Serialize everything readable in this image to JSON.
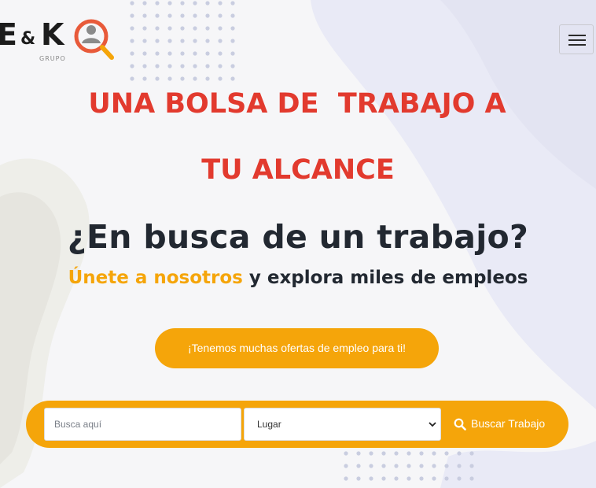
{
  "brand": {
    "letter_e": "E",
    "ampersand": "&",
    "letter_k": "K",
    "sub": "GRUPO",
    "accent_color": "#e23a2e",
    "orange": "#f5a50a"
  },
  "nav": {
    "menu_icon": "hamburger-icon"
  },
  "hero": {
    "line1": "UNA BOLSA DE  TRABAJO A",
    "line2": "TU ALCANCE",
    "subtitle": "¿En busca de un trabajo?",
    "tagline_highlight": "Únete a nosotros",
    "tagline_rest": " y explora miles de empleos"
  },
  "offers_button": {
    "label": "¡Tenemos muchas ofertas de empleo para ti!"
  },
  "search": {
    "placeholder": "Busca aquí",
    "location_selected": "Lugar",
    "button_label": "Buscar Trabajo",
    "button_icon": "search-icon"
  }
}
